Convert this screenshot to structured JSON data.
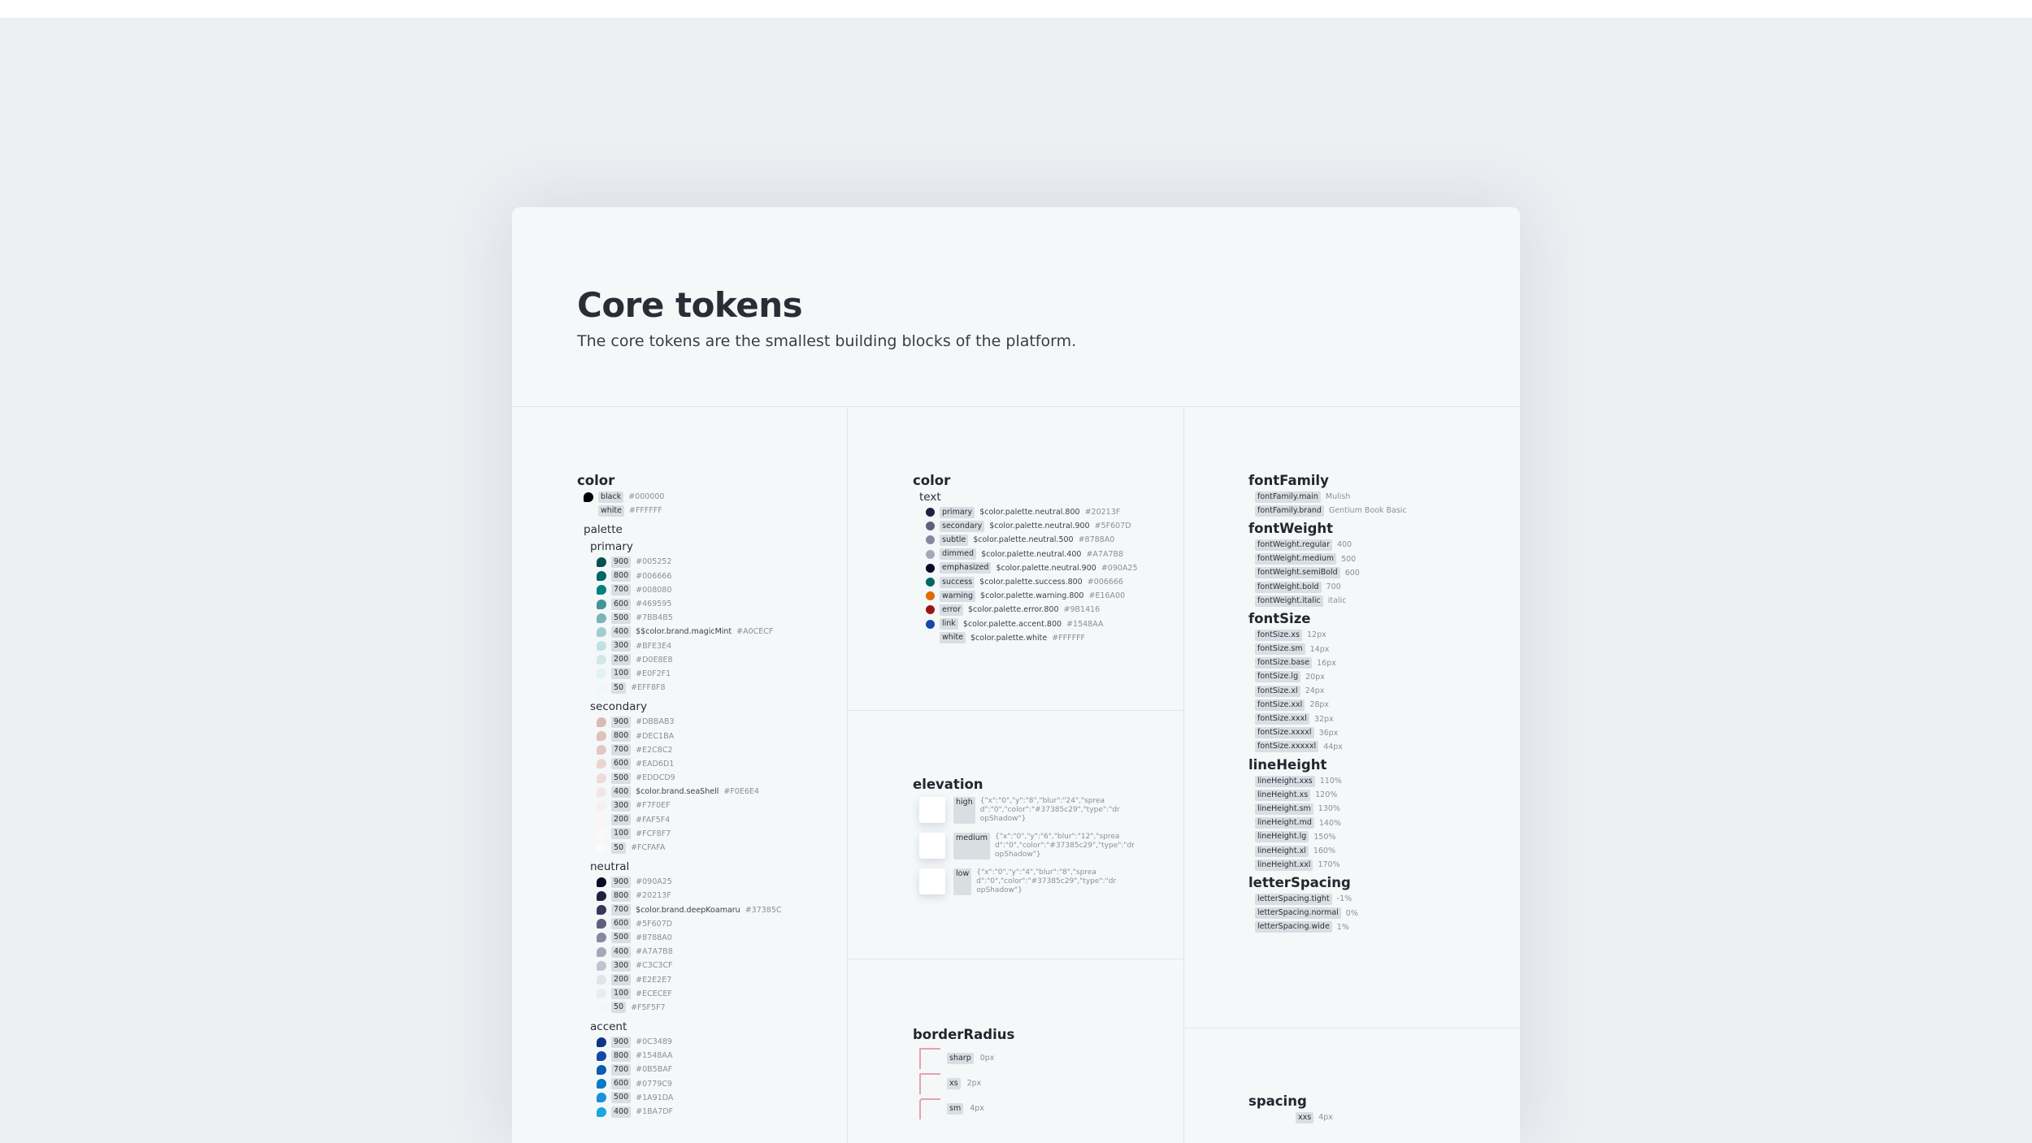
{
  "page": {
    "title": "Core tokens",
    "subtitle": "The core tokens are the smallest building blocks of the platform."
  },
  "color_core": {
    "heading": "color",
    "base": [
      {
        "name": "black",
        "value": "#000000",
        "hex": "#000000"
      },
      {
        "name": "white",
        "value": "#FFFFFF",
        "hex": "#FFFFFF"
      }
    ],
    "palette_label": "palette",
    "groups": [
      {
        "label": "primary",
        "items": [
          {
            "name": "900",
            "value": "#005252",
            "hex": "#005252"
          },
          {
            "name": "800",
            "value": "#006666",
            "hex": "#006666"
          },
          {
            "name": "700",
            "value": "#008080",
            "hex": "#008080"
          },
          {
            "name": "600",
            "value": "#469595",
            "hex": "#469595"
          },
          {
            "name": "500",
            "value": "#7BB4B5",
            "hex": "#7BB4B5"
          },
          {
            "name": "400",
            "ref": "$$color.brand.magicMint",
            "value": "#A0CECF",
            "hex": "#A0CECF"
          },
          {
            "name": "300",
            "value": "#BFE3E4",
            "hex": "#BFE3E4"
          },
          {
            "name": "200",
            "value": "#D0E8E8",
            "hex": "#D0E8E8"
          },
          {
            "name": "100",
            "value": "#E0F2F1",
            "hex": "#E0F2F1"
          },
          {
            "name": "50",
            "value": "#EFF8F8",
            "hex": "#EFF8F8"
          }
        ]
      },
      {
        "label": "secondary",
        "items": [
          {
            "name": "900",
            "value": "#DBBAB3",
            "hex": "#DBBAB3"
          },
          {
            "name": "800",
            "value": "#DEC1BA",
            "hex": "#DEC1BA"
          },
          {
            "name": "700",
            "value": "#E2C8C2",
            "hex": "#E2C8C2"
          },
          {
            "name": "600",
            "value": "#EAD6D1",
            "hex": "#EAD6D1"
          },
          {
            "name": "500",
            "value": "#EDDCD9",
            "hex": "#EDDCD9"
          },
          {
            "name": "400",
            "ref": "$color.brand.seaShell",
            "value": "#F0E6E4",
            "hex": "#F0E6E4"
          },
          {
            "name": "300",
            "value": "#F7F0EF",
            "hex": "#F7F0EF"
          },
          {
            "name": "200",
            "value": "#FAF5F4",
            "hex": "#FAF5F4"
          },
          {
            "name": "100",
            "value": "#FCF8F7",
            "hex": "#FCF8F7"
          },
          {
            "name": "50",
            "value": "#FCFAFA",
            "hex": "#FCFAFA"
          }
        ]
      },
      {
        "label": "neutral",
        "items": [
          {
            "name": "900",
            "value": "#090A25",
            "hex": "#090A25"
          },
          {
            "name": "800",
            "value": "#20213F",
            "hex": "#20213F"
          },
          {
            "name": "700",
            "ref": "$color.brand.deepKoamaru",
            "value": "#37385C",
            "hex": "#37385C"
          },
          {
            "name": "600",
            "value": "#5F607D",
            "hex": "#5F607D"
          },
          {
            "name": "500",
            "value": "#8788A0",
            "hex": "#8788A0"
          },
          {
            "name": "400",
            "value": "#A7A7B8",
            "hex": "#A7A7B8"
          },
          {
            "name": "300",
            "value": "#C3C3CF",
            "hex": "#C3C3CF"
          },
          {
            "name": "200",
            "value": "#E2E2E7",
            "hex": "#E2E2E7"
          },
          {
            "name": "100",
            "value": "#ECECEF",
            "hex": "#ECECEF"
          },
          {
            "name": "50",
            "value": "#F5F5F7",
            "hex": "#F5F5F7"
          }
        ]
      },
      {
        "label": "accent",
        "items": [
          {
            "name": "900",
            "value": "#0C3489",
            "hex": "#0C3489"
          },
          {
            "name": "800",
            "value": "#1548AA",
            "hex": "#1548AA"
          },
          {
            "name": "700",
            "value": "#0B5BAF",
            "hex": "#0B5BAF"
          },
          {
            "name": "600",
            "value": "#0779C9",
            "hex": "#0779C9"
          },
          {
            "name": "500",
            "value": "#1A91DA",
            "hex": "#1A91DA"
          },
          {
            "name": "400",
            "value": "#1BA7DF",
            "hex": "#1BA7DF"
          }
        ]
      }
    ]
  },
  "color_text": {
    "heading": "color",
    "sub": "text",
    "items": [
      {
        "name": "primary",
        "ref": "$color.palette.neutral.800",
        "value": "#20213F",
        "hex": "#20213F"
      },
      {
        "name": "secondary",
        "ref": "$color.palette.neutral.900",
        "value": "#5F607D",
        "hex": "#5F607D"
      },
      {
        "name": "subtle",
        "ref": "$color.palette.neutral.500",
        "value": "#8788A0",
        "hex": "#8788A0"
      },
      {
        "name": "dimmed",
        "ref": "$color.palette.neutral.400",
        "value": "#A7A7B8",
        "hex": "#A7A7B8"
      },
      {
        "name": "emphasized",
        "ref": "$color.palette.neutral.900",
        "value": "#090A25",
        "hex": "#090A25"
      },
      {
        "name": "success",
        "ref": "$color.palette.success.800",
        "value": "#006666",
        "hex": "#006666"
      },
      {
        "name": "warning",
        "ref": "$color.palette.warning.800",
        "value": "#E16A00",
        "hex": "#E16A00"
      },
      {
        "name": "error",
        "ref": "$color.palette.error.800",
        "value": "#9B1416",
        "hex": "#9B1416"
      },
      {
        "name": "link",
        "ref": "$color.palette.accent.800",
        "value": "#1548AA",
        "hex": "#1548AA"
      },
      {
        "name": "white",
        "ref": "$color.palette.white",
        "value": "#FFFFFF",
        "hex": "#FFFFFF"
      }
    ]
  },
  "elevation": {
    "heading": "elevation",
    "items": [
      {
        "name": "high",
        "value": "{\"x\":\"0\",\"y\":\"8\",\"blur\":\"24\",\"spread\":\"0\",\"color\":\"#37385c29\",\"type\":\"dropShadow\"}"
      },
      {
        "name": "medium",
        "value": "{\"x\":\"0\",\"y\":\"6\",\"blur\":\"12\",\"spread\":\"0\",\"color\":\"#37385c29\",\"type\":\"dropShadow\"}"
      },
      {
        "name": "low",
        "value": "{\"x\":\"0\",\"y\":\"4\",\"blur\":\"8\",\"spread\":\"0\",\"color\":\"#37385c29\",\"type\":\"dropShadow\"}"
      }
    ]
  },
  "borderRadius": {
    "heading": "borderRadius",
    "items": [
      {
        "name": "sharp",
        "value": "0px"
      },
      {
        "name": "xs",
        "value": "2px"
      },
      {
        "name": "sm",
        "value": "4px"
      }
    ]
  },
  "typography": {
    "fontFamily": {
      "heading": "fontFamily",
      "items": [
        {
          "name": "fontFamily.main",
          "value": "Mulish"
        },
        {
          "name": "fontFamily.brand",
          "value": "Gentium Book Basic"
        }
      ]
    },
    "fontWeight": {
      "heading": "fontWeight",
      "items": [
        {
          "name": "fontWeight.regular",
          "value": "400"
        },
        {
          "name": "fontWeight.medium",
          "value": "500"
        },
        {
          "name": "fontWeight.semiBold",
          "value": "600"
        },
        {
          "name": "fontWeight.bold",
          "value": "700"
        },
        {
          "name": "fontWeight.italic",
          "value": "italic"
        }
      ]
    },
    "fontSize": {
      "heading": "fontSize",
      "items": [
        {
          "name": "fontSize.xs",
          "value": "12px"
        },
        {
          "name": "fontSize.sm",
          "value": "14px"
        },
        {
          "name": "fontSize.base",
          "value": "16px"
        },
        {
          "name": "fontSize.lg",
          "value": "20px"
        },
        {
          "name": "fontSize.xl",
          "value": "24px"
        },
        {
          "name": "fontSize.xxl",
          "value": "28px"
        },
        {
          "name": "fontSize.xxxl",
          "value": "32px"
        },
        {
          "name": "fontSize.xxxxl",
          "value": "36px"
        },
        {
          "name": "fontSize.xxxxxl",
          "value": "44px"
        }
      ]
    },
    "lineHeight": {
      "heading": "lineHeight",
      "items": [
        {
          "name": "lineHeight.xxs",
          "value": "110%"
        },
        {
          "name": "lineHeight.xs",
          "value": "120%"
        },
        {
          "name": "lineHeight.sm",
          "value": "130%"
        },
        {
          "name": "lineHeight.md",
          "value": "140%"
        },
        {
          "name": "lineHeight.lg",
          "value": "150%"
        },
        {
          "name": "lineHeight.xl",
          "value": "160%"
        },
        {
          "name": "lineHeight.xxl",
          "value": "170%"
        }
      ]
    },
    "letterSpacing": {
      "heading": "letterSpacing",
      "items": [
        {
          "name": "letterSpacing.tight",
          "value": "-1%"
        },
        {
          "name": "letterSpacing.normal",
          "value": "0%"
        },
        {
          "name": "letterSpacing.wide",
          "value": "1%"
        }
      ]
    }
  },
  "spacing": {
    "heading": "spacing",
    "items": [
      {
        "name": "xxs",
        "value": "4px"
      }
    ]
  }
}
